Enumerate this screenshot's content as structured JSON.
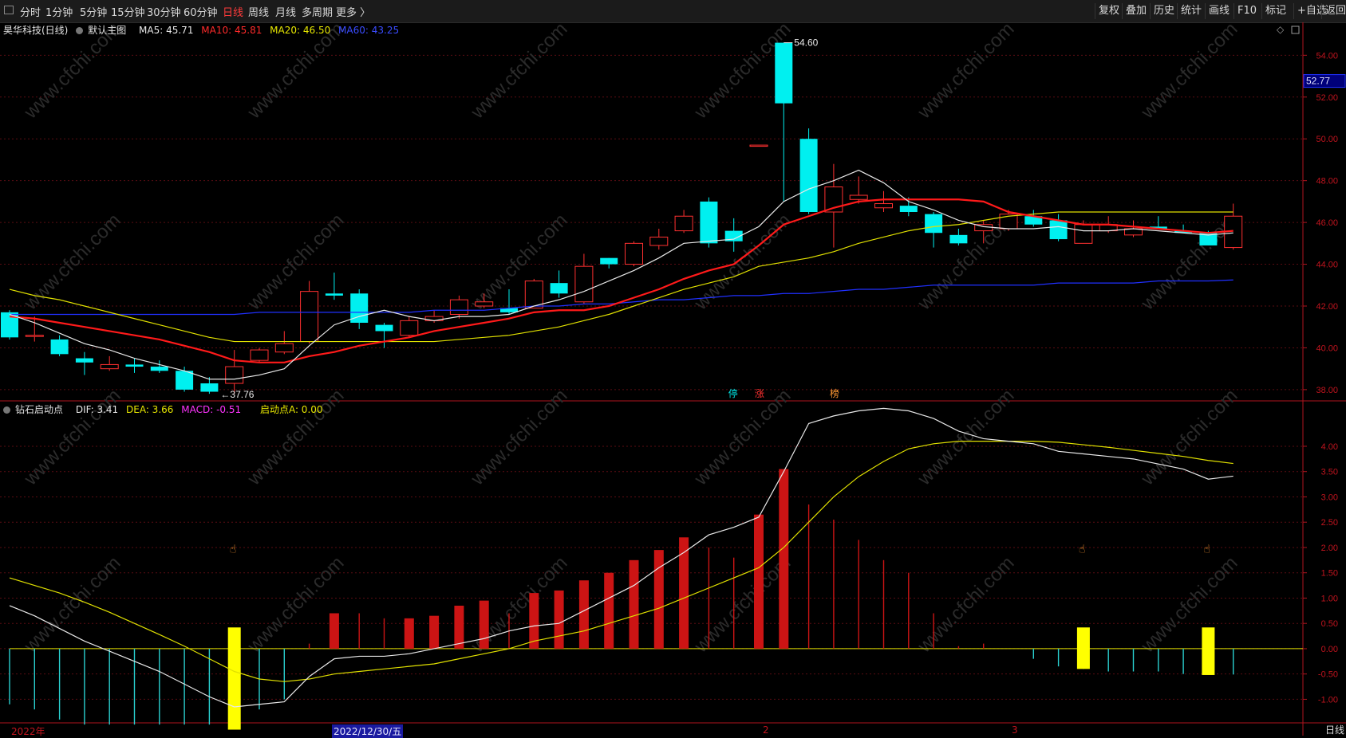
{
  "toolbar": {
    "left_items": [
      "分时",
      "1分钟",
      "5分钟",
      "15分钟",
      "30分钟",
      "60分钟",
      "日线",
      "周线",
      "月线",
      "多周期",
      "更多 〉"
    ],
    "active_item": "日线",
    "right_items": [
      "复权",
      "叠加",
      "历史",
      "统计",
      "画线",
      "F10",
      "+自选",
      "返回"
    ],
    "marker_label": "标记"
  },
  "price_panel": {
    "stock": "昊华科技(日线)",
    "template": "默认主图",
    "ma5": "MA5: 45.71",
    "ma10": "MA10: 45.81",
    "ma20": "MA20: 46.50",
    "ma60": "MA60: 43.25",
    "high_label": "54.60",
    "low_label": "37.76",
    "current_price_tag": "52.77",
    "yticks": [
      "54.00",
      "52.00",
      "50.00",
      "48.00",
      "46.00",
      "44.00",
      "42.00",
      "40.00",
      "38.00"
    ],
    "markers": [
      "停",
      "涨",
      "榜"
    ],
    "colors": {
      "up": "#ff3030",
      "down": "#00f0f0",
      "ma5": "#e8e8e8",
      "ma10": "#ff1a1a",
      "ma20": "#e0e000",
      "ma60": "#2030ff"
    }
  },
  "indicator_panel": {
    "name": "钻石启动点",
    "dif": "DIF: 3.41",
    "dea": "DEA: 3.66",
    "macd": "MACD: -0.51",
    "start": "启动点A: 0.00",
    "yticks": [
      "4.00",
      "3.50",
      "3.00",
      "2.50",
      "2.00",
      "1.50",
      "1.00",
      "0.50",
      "0.00",
      "-0.50",
      "-1.00"
    ]
  },
  "bottom": {
    "year_label": "2022年",
    "date_label": "2022/12/30/五",
    "tick_2": "2",
    "tick_3": "3",
    "period": "日线"
  },
  "watermark": "www.cfchi.com",
  "chart_data": {
    "type": "candlestick",
    "price_ylim": [
      37.5,
      55.5
    ],
    "candles": [
      {
        "o": 41.7,
        "h": 41.8,
        "c": 40.5,
        "l": 40.4
      },
      {
        "o": 40.6,
        "h": 41.5,
        "c": 40.6,
        "l": 40.3
      },
      {
        "o": 40.4,
        "h": 40.6,
        "c": 39.7,
        "l": 39.6
      },
      {
        "o": 39.5,
        "h": 39.8,
        "c": 39.3,
        "l": 38.7
      },
      {
        "o": 39.0,
        "h": 39.6,
        "c": 39.2,
        "l": 38.9
      },
      {
        "o": 39.2,
        "h": 39.5,
        "c": 39.1,
        "l": 38.8
      },
      {
        "o": 39.1,
        "h": 39.4,
        "c": 38.9,
        "l": 38.8
      },
      {
        "o": 38.9,
        "h": 39.1,
        "c": 38.0,
        "l": 37.9
      },
      {
        "o": 38.3,
        "h": 38.6,
        "c": 37.9,
        "l": 37.8
      },
      {
        "o": 38.3,
        "h": 39.9,
        "c": 39.1,
        "l": 37.8
      },
      {
        "o": 39.4,
        "h": 40.0,
        "c": 39.9,
        "l": 39.3
      },
      {
        "o": 39.8,
        "h": 40.8,
        "c": 40.2,
        "l": 39.7
      },
      {
        "o": 40.3,
        "h": 43.2,
        "c": 42.7,
        "l": 40.2
      },
      {
        "o": 42.6,
        "h": 43.6,
        "c": 42.5,
        "l": 42.3
      },
      {
        "o": 42.6,
        "h": 42.8,
        "c": 41.2,
        "l": 40.9
      },
      {
        "o": 41.1,
        "h": 41.2,
        "c": 40.8,
        "l": 40.0
      },
      {
        "o": 40.6,
        "h": 41.5,
        "c": 41.3,
        "l": 40.5
      },
      {
        "o": 41.3,
        "h": 41.8,
        "c": 41.5,
        "l": 41.2
      },
      {
        "o": 41.6,
        "h": 42.5,
        "c": 42.3,
        "l": 41.4
      },
      {
        "o": 42.0,
        "h": 42.6,
        "c": 42.2,
        "l": 41.9
      },
      {
        "o": 41.9,
        "h": 42.8,
        "c": 41.7,
        "l": 41.6
      },
      {
        "o": 41.9,
        "h": 43.3,
        "c": 43.2,
        "l": 41.9
      },
      {
        "o": 43.1,
        "h": 43.7,
        "c": 42.6,
        "l": 42.4
      },
      {
        "o": 42.2,
        "h": 44.5,
        "c": 43.9,
        "l": 42.1
      },
      {
        "o": 44.3,
        "h": 44.3,
        "c": 44.0,
        "l": 43.8
      },
      {
        "o": 44.0,
        "h": 45.1,
        "c": 45.0,
        "l": 43.9
      },
      {
        "o": 44.9,
        "h": 45.7,
        "c": 45.3,
        "l": 44.7
      },
      {
        "o": 45.6,
        "h": 46.6,
        "c": 46.3,
        "l": 45.5
      },
      {
        "o": 47.0,
        "h": 47.2,
        "c": 45.0,
        "l": 44.8
      },
      {
        "o": 45.6,
        "h": 46.2,
        "c": 45.1,
        "l": 44.6
      },
      {
        "o": 49.7,
        "h": 49.7,
        "c": 49.7,
        "l": 49.7
      },
      {
        "o": 54.6,
        "h": 54.6,
        "c": 51.7,
        "l": 47.0
      },
      {
        "o": 50.0,
        "h": 50.5,
        "c": 46.5,
        "l": 46.4
      },
      {
        "o": 46.5,
        "h": 48.8,
        "c": 47.7,
        "l": 44.8
      },
      {
        "o": 47.1,
        "h": 48.2,
        "c": 47.3,
        "l": 46.9
      },
      {
        "o": 46.7,
        "h": 47.5,
        "c": 46.9,
        "l": 46.5
      },
      {
        "o": 46.8,
        "h": 47.2,
        "c": 46.5,
        "l": 46.3
      },
      {
        "o": 46.4,
        "h": 46.5,
        "c": 45.5,
        "l": 44.8
      },
      {
        "o": 45.4,
        "h": 45.7,
        "c": 45.0,
        "l": 44.9
      },
      {
        "o": 45.6,
        "h": 46.1,
        "c": 45.9,
        "l": 45.0
      },
      {
        "o": 45.7,
        "h": 46.6,
        "c": 46.4,
        "l": 45.6
      },
      {
        "o": 46.3,
        "h": 46.6,
        "c": 45.9,
        "l": 45.8
      },
      {
        "o": 46.1,
        "h": 46.4,
        "c": 45.2,
        "l": 45.1
      },
      {
        "o": 45.0,
        "h": 46.1,
        "c": 45.9,
        "l": 45.0
      },
      {
        "o": 45.6,
        "h": 46.3,
        "c": 45.9,
        "l": 45.5
      },
      {
        "o": 45.4,
        "h": 46.1,
        "c": 45.7,
        "l": 45.3
      },
      {
        "o": 45.8,
        "h": 46.3,
        "c": 45.7,
        "l": 45.7
      },
      {
        "o": 45.6,
        "h": 45.9,
        "c": 45.5,
        "l": 45.5
      },
      {
        "o": 45.5,
        "h": 45.6,
        "c": 44.9,
        "l": 44.9
      },
      {
        "o": 44.8,
        "h": 46.9,
        "c": 46.3,
        "l": 44.7
      }
    ],
    "ma5": [
      41.6,
      41.2,
      40.7,
      40.2,
      39.9,
      39.5,
      39.2,
      38.9,
      38.5,
      38.5,
      38.7,
      39.0,
      40.1,
      41.1,
      41.5,
      41.8,
      41.5,
      41.3,
      41.5,
      41.5,
      41.6,
      42.0,
      42.3,
      42.7,
      43.2,
      43.7,
      44.3,
      45.0,
      45.1,
      45.2,
      45.8,
      47.0,
      47.6,
      48.0,
      48.5,
      47.9,
      47.0,
      46.6,
      46.1,
      45.8,
      45.7,
      45.7,
      45.8,
      45.6,
      45.6,
      45.7,
      45.6,
      45.5,
      45.4,
      45.5
    ],
    "ma10": [
      41.5,
      41.4,
      41.2,
      41.0,
      40.8,
      40.6,
      40.4,
      40.1,
      39.8,
      39.4,
      39.3,
      39.3,
      39.6,
      39.8,
      40.1,
      40.3,
      40.5,
      40.8,
      41.0,
      41.2,
      41.4,
      41.7,
      41.8,
      41.8,
      42.0,
      42.4,
      42.8,
      43.3,
      43.7,
      44.0,
      44.9,
      45.9,
      46.3,
      46.7,
      47.0,
      47.1,
      47.1,
      47.1,
      47.1,
      47.0,
      46.5,
      46.3,
      46.1,
      45.9,
      45.9,
      45.8,
      45.7,
      45.6,
      45.5,
      45.6
    ],
    "ma20": [
      42.8,
      42.5,
      42.3,
      42.0,
      41.7,
      41.4,
      41.1,
      40.8,
      40.5,
      40.3,
      40.3,
      40.3,
      40.3,
      40.3,
      40.3,
      40.3,
      40.3,
      40.3,
      40.4,
      40.5,
      40.6,
      40.8,
      41.0,
      41.3,
      41.6,
      42.0,
      42.4,
      42.8,
      43.1,
      43.4,
      43.9,
      44.1,
      44.3,
      44.6,
      45.0,
      45.3,
      45.6,
      45.8,
      45.9,
      46.1,
      46.3,
      46.4,
      46.5,
      46.5,
      46.5,
      46.5,
      46.5,
      46.5,
      46.5,
      46.5
    ],
    "ma60": [
      41.6,
      41.6,
      41.6,
      41.6,
      41.6,
      41.6,
      41.6,
      41.6,
      41.6,
      41.6,
      41.7,
      41.7,
      41.7,
      41.7,
      41.7,
      41.7,
      41.7,
      41.8,
      41.8,
      41.8,
      41.9,
      42.0,
      42.0,
      42.1,
      42.1,
      42.2,
      42.3,
      42.3,
      42.4,
      42.5,
      42.5,
      42.6,
      42.6,
      42.7,
      42.8,
      42.8,
      42.9,
      43.0,
      43.0,
      43.0,
      43.0,
      43.0,
      43.1,
      43.1,
      43.1,
      43.1,
      43.2,
      43.2,
      43.2,
      43.25
    ],
    "indicator_ylim": [
      -1.45,
      4.85
    ],
    "dif": [
      0.85,
      0.65,
      0.4,
      0.15,
      -0.05,
      -0.25,
      -0.45,
      -0.7,
      -0.95,
      -1.15,
      -1.1,
      -1.05,
      -0.55,
      -0.2,
      -0.15,
      -0.15,
      -0.1,
      0.0,
      0.1,
      0.2,
      0.35,
      0.45,
      0.5,
      0.75,
      1.0,
      1.25,
      1.6,
      1.9,
      2.25,
      2.4,
      2.6,
      3.5,
      4.45,
      4.6,
      4.7,
      4.75,
      4.7,
      4.55,
      4.3,
      4.15,
      4.1,
      4.05,
      3.9,
      3.85,
      3.8,
      3.75,
      3.65,
      3.55,
      3.35,
      3.41
    ],
    "dea": [
      1.4,
      1.25,
      1.1,
      0.92,
      0.72,
      0.5,
      0.28,
      0.05,
      -0.2,
      -0.45,
      -0.6,
      -0.65,
      -0.6,
      -0.5,
      -0.45,
      -0.4,
      -0.35,
      -0.3,
      -0.2,
      -0.1,
      0.0,
      0.15,
      0.25,
      0.35,
      0.5,
      0.65,
      0.8,
      1.0,
      1.2,
      1.4,
      1.6,
      2.0,
      2.5,
      3.0,
      3.4,
      3.7,
      3.95,
      4.05,
      4.1,
      4.1,
      4.1,
      4.1,
      4.08,
      4.03,
      3.98,
      3.92,
      3.86,
      3.8,
      3.72,
      3.66
    ],
    "macd": [
      -1.1,
      -1.2,
      -1.4,
      -1.5,
      -1.5,
      -1.5,
      -1.5,
      -1.5,
      -1.5,
      -1.4,
      -1.2,
      -1.0,
      0.1,
      0.7,
      0.7,
      0.6,
      0.6,
      0.65,
      0.85,
      0.95,
      0.7,
      1.1,
      1.15,
      1.35,
      1.5,
      1.75,
      1.95,
      2.2,
      2.0,
      1.8,
      2.65,
      3.55,
      2.85,
      2.55,
      2.15,
      1.75,
      1.5,
      0.7,
      0.05,
      0.1,
      0.0,
      -0.2,
      -0.35,
      -0.4,
      -0.45,
      -0.45,
      -0.45,
      -0.5,
      -0.5,
      -0.51
    ],
    "signal_bars": [
      {
        "i": 9,
        "top": 0.42,
        "bottom": -1.6
      },
      {
        "i": 43,
        "top": 0.42,
        "bottom": -0.4
      },
      {
        "i": 48,
        "top": 0.42,
        "bottom": -0.52
      }
    ],
    "hand_markers": [
      9,
      43,
      48
    ]
  }
}
